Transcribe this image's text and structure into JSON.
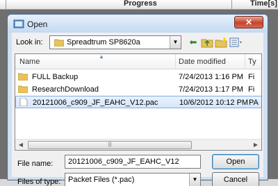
{
  "background_app": {
    "columns": [
      "Progress",
      "Time[s]"
    ]
  },
  "dialog": {
    "title": "Open",
    "close_label": "✕",
    "look_in": {
      "label": "Look in:",
      "value": "Spreadtrum SP8620a"
    },
    "toolbar": {
      "back_icon": "back-arrow-icon",
      "up_icon": "up-folder-icon",
      "new_folder_icon": "new-folder-icon",
      "views_icon": "views-menu-icon"
    },
    "columns": {
      "name": "Name",
      "date_modified": "Date modified",
      "type": "Ty"
    },
    "files": [
      {
        "name": "FULL Backup",
        "date": "7/24/2013 1:16 PM",
        "type": "Fi",
        "kind": "folder"
      },
      {
        "name": "ResearchDownload",
        "date": "7/24/2013 1:17 PM",
        "type": "Fi",
        "kind": "folder"
      },
      {
        "name": "20121006_c909_JF_EAHC_V12.pac",
        "date": "10/6/2012 10:12 PM",
        "type": "PA",
        "kind": "file",
        "selected": true
      }
    ],
    "file_name": {
      "label": "File name:",
      "value": "20121006_c909_JF_EAHC_V12"
    },
    "file_type": {
      "label": "Files of type:",
      "value": "Packet Files (*.pac)"
    },
    "open_label": "Open",
    "cancel_label": "Cancel"
  },
  "colors": {
    "dialog_frame": "#cfe0f3",
    "selection": "#d5e6fb",
    "close_button": "#c8432b",
    "folder": "#e8c25a"
  }
}
